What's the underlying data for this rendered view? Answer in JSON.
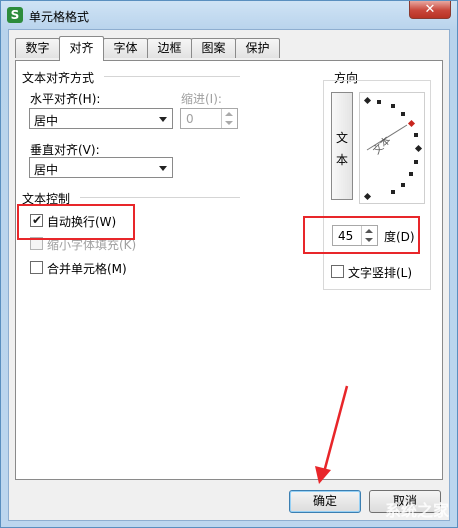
{
  "window": {
    "title": "单元格格式",
    "icon_letter": "S",
    "close_glyph": "✕"
  },
  "tabs": [
    {
      "label": "数字",
      "active": false
    },
    {
      "label": "对齐",
      "active": true
    },
    {
      "label": "字体",
      "active": false
    },
    {
      "label": "边框",
      "active": false
    },
    {
      "label": "图案",
      "active": false
    },
    {
      "label": "保护",
      "active": false
    }
  ],
  "alignment": {
    "group_title": "文本对齐方式",
    "horizontal_label": "水平对齐(H):",
    "horizontal_value": "居中",
    "indent_label": "缩进(I):",
    "indent_value": "0",
    "vertical_label": "垂直对齐(V):",
    "vertical_value": "居中"
  },
  "text_control": {
    "group_title": "文本控制",
    "wrap_label": "自动换行(W)",
    "wrap_checked": true,
    "shrink_label": "缩小字体填充(K)",
    "shrink_checked": false,
    "merge_label": "合并单元格(M)",
    "merge_checked": false
  },
  "orientation": {
    "group_title": "方向",
    "vertical_text_char1": "文",
    "vertical_text_char2": "本",
    "dial_text": "文本",
    "degrees_value": "45",
    "degrees_label": "度(D)",
    "stack_label": "文字竖排(L)",
    "stack_checked": false
  },
  "buttons": {
    "ok_label": "确定",
    "cancel_label": "取消"
  },
  "watermark": "系统之家",
  "colors": {
    "highlight": "#e8262a",
    "title_bar": "#cfe3f5"
  }
}
